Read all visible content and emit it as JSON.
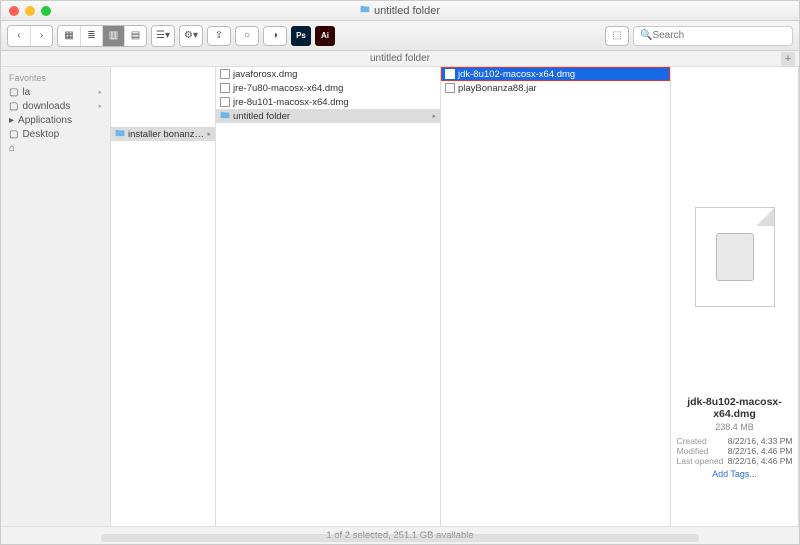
{
  "window": {
    "title": "untitled folder",
    "pathbar": "untitled folder"
  },
  "toolbar": {
    "search_placeholder": "Search"
  },
  "sidebar": {
    "header": "Favorites",
    "items": [
      {
        "label": "la"
      },
      {
        "label": "downloads"
      },
      {
        "label": "Applications"
      },
      {
        "label": "Desktop"
      },
      {
        "label": ""
      }
    ]
  },
  "columns": {
    "c1": [
      {
        "label": "installer bonanza88",
        "type": "folder",
        "selected": true
      }
    ],
    "c2": [
      {
        "label": "javaforosx.dmg",
        "type": "file"
      },
      {
        "label": "jre-7u80-macosx-x64.dmg",
        "type": "file"
      },
      {
        "label": "jre-8u101-macosx-x64.dmg",
        "type": "file"
      },
      {
        "label": "untitled folder",
        "type": "folder",
        "selected": true
      }
    ],
    "c3": [
      {
        "label": "jdk-8u102-macosx-x64.dmg",
        "type": "file",
        "highlighted": true
      },
      {
        "label": "playBonanza88.jar",
        "type": "file"
      }
    ]
  },
  "preview": {
    "name": "jdk-8u102-macosx-x64.dmg",
    "size": "238.4 MB",
    "meta": [
      {
        "label": "Created",
        "value": "8/22/16, 4:33 PM"
      },
      {
        "label": "Modified",
        "value": "8/22/16, 4:46 PM"
      },
      {
        "label": "Last opened",
        "value": "8/22/16, 4:46 PM"
      }
    ],
    "add_tags": "Add Tags..."
  },
  "status": "1 of 2 selected, 251.1 GB available"
}
